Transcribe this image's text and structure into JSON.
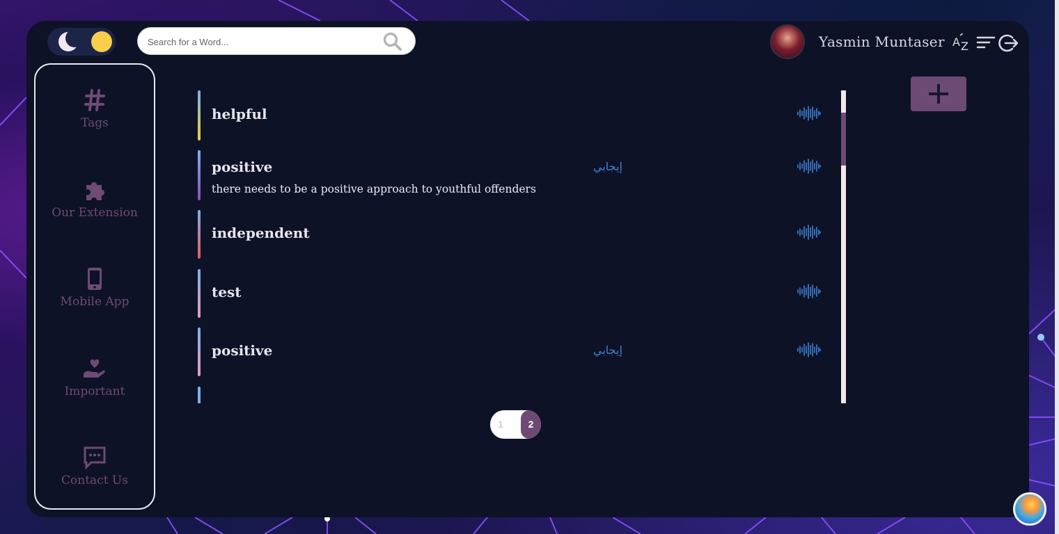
{
  "search": {
    "placeholder": "Search for a Word..."
  },
  "user": {
    "name": "Yasmin Muntaser"
  },
  "sidebar": {
    "items": [
      {
        "label": "Tags",
        "icon": "hashtag-icon"
      },
      {
        "label": "Our Extension",
        "icon": "puzzle-icon"
      },
      {
        "label": "Mobile App",
        "icon": "mobile-phone-icon"
      },
      {
        "label": "Important",
        "icon": "heart-hand-icon"
      },
      {
        "label": "Contact Us",
        "icon": "chat-bubble-icon"
      }
    ]
  },
  "words": [
    {
      "term": "helpful",
      "translation": "",
      "example": "",
      "bar_colors": [
        "#7fb0e8",
        "#e8d23a"
      ]
    },
    {
      "term": "positive",
      "translation": "إيجابي",
      "example": "there needs to be a positive approach to youthful offenders",
      "bar_colors": [
        "#7fb0e8",
        "#8a52b8"
      ]
    },
    {
      "term": "independent",
      "translation": "",
      "example": "",
      "bar_colors": [
        "#7fb0e8",
        "#e0605a"
      ]
    },
    {
      "term": "test",
      "translation": "",
      "example": "",
      "bar_colors": [
        "#7fb0e8",
        "#e59bc2"
      ]
    },
    {
      "term": "positive",
      "translation": "إيجابي",
      "example": "",
      "bar_colors": [
        "#7fb0e8",
        "#e59bc2"
      ]
    }
  ],
  "pagination": {
    "pages": [
      "1",
      "2"
    ],
    "current": "2"
  },
  "colors": {
    "accent": "#6d4a73",
    "translation": "#3f83d6",
    "background": "#0e1226",
    "sidebar_text": "#6e4a76"
  }
}
